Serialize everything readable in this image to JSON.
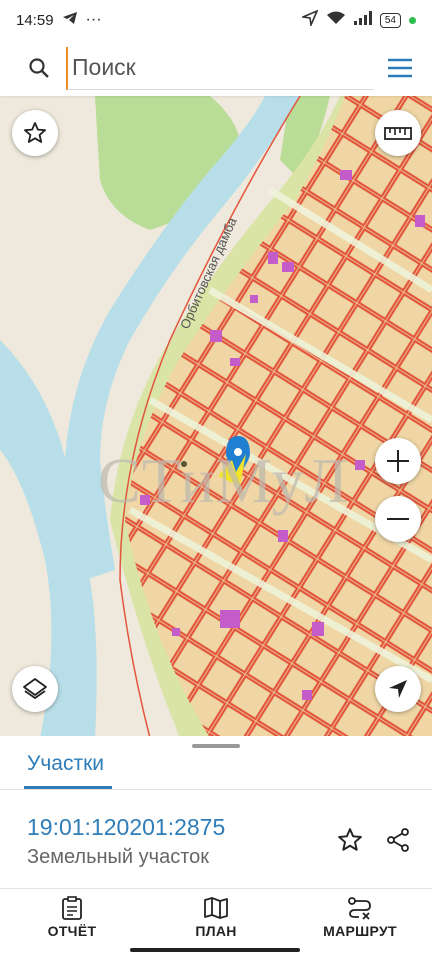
{
  "status_bar": {
    "time": "14:59",
    "battery": "54"
  },
  "search": {
    "placeholder": "Поиск"
  },
  "map": {
    "street_label": "Орбитовская дамба",
    "watermark": "СТиМуЛ"
  },
  "colors": {
    "accent": "#2f7db8",
    "parcel_stroke": "#e2553c",
    "parcel_fill": "#efd6a4",
    "water": "#b8dfe9",
    "forest": "#b9dc96"
  },
  "sheet": {
    "tab_label": "Участки",
    "parcel_number": "19:01:120201:2875",
    "parcel_type": "Земельный участок"
  },
  "bottom_nav": {
    "items": [
      {
        "label": "ОТЧЁТ",
        "icon": "report-icon"
      },
      {
        "label": "ПЛАН",
        "icon": "map-icon"
      },
      {
        "label": "МАРШРУТ",
        "icon": "route-icon"
      }
    ]
  }
}
